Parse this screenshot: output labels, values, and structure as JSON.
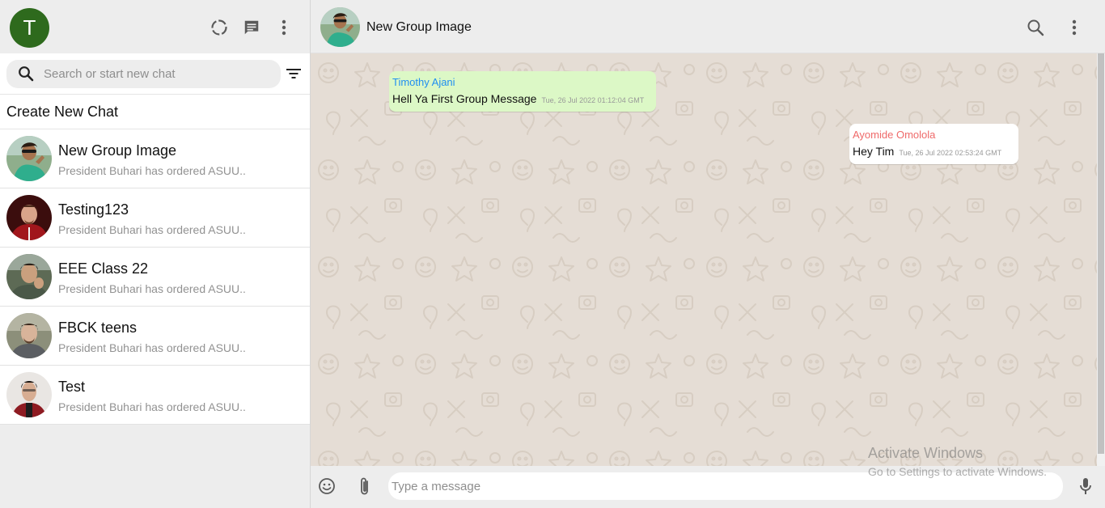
{
  "user": {
    "initial": "T",
    "avatar_color": "#2e6a1d"
  },
  "sidebar": {
    "search_placeholder": "Search or start new chat",
    "create_new_chat": "Create New Chat",
    "chats": [
      {
        "name": "New Group Image",
        "preview": "President Buhari has ordered ASUU.."
      },
      {
        "name": "Testing123",
        "preview": "President Buhari has ordered ASUU.."
      },
      {
        "name": "EEE Class 22",
        "preview": "President Buhari has ordered ASUU.."
      },
      {
        "name": "FBCK teens",
        "preview": "President Buhari has ordered ASUU.."
      },
      {
        "name": "Test",
        "preview": "President Buhari has ordered ASUU.."
      }
    ]
  },
  "chat": {
    "title": "New Group Image",
    "messages": [
      {
        "sender": "Timothy Ajani",
        "text": "Hell Ya First Group Message",
        "time": "Tue, 26 Jul 2022 01:12:04 GMT",
        "sender_color": "#1f8ef1",
        "bubble_color": "#dcf8c6"
      },
      {
        "sender": "Ayomide Omolola",
        "text": "Hey Tim",
        "time": "Tue, 26 Jul 2022 02:53:24 GMT",
        "sender_color": "#ef6a6a",
        "bubble_color": "#ffffff"
      }
    ],
    "input_placeholder": "Type a message"
  },
  "watermark": {
    "line1": "Activate Windows",
    "line2": "Go to Settings to activate Windows."
  },
  "icons": [
    "status-icon",
    "new-chat-icon",
    "menu-dots-icon",
    "search-icon",
    "filter-icon",
    "emoji-icon",
    "attach-icon",
    "mic-icon"
  ]
}
